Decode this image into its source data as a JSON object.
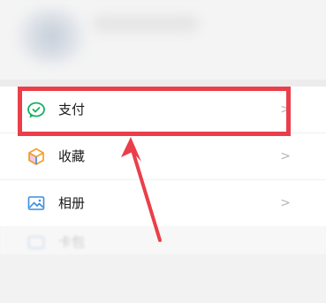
{
  "menu": {
    "items": [
      {
        "label": "支付",
        "icon": "wechat-pay-icon",
        "chevron": ">"
      },
      {
        "label": "收藏",
        "icon": "favorites-cube-icon",
        "chevron": ">"
      },
      {
        "label": "相册",
        "icon": "album-picture-icon",
        "chevron": ">"
      },
      {
        "label": "卡包",
        "icon": "card-wallet-icon"
      }
    ]
  },
  "annotation": {
    "highlight_color": "#ea3f4a",
    "target": "支付"
  },
  "colors": {
    "pay_green": "#14b05f",
    "favorites_orange": "#f5a025",
    "favorites_blue": "#3b8fe6",
    "album_blue": "#3a8dde"
  }
}
